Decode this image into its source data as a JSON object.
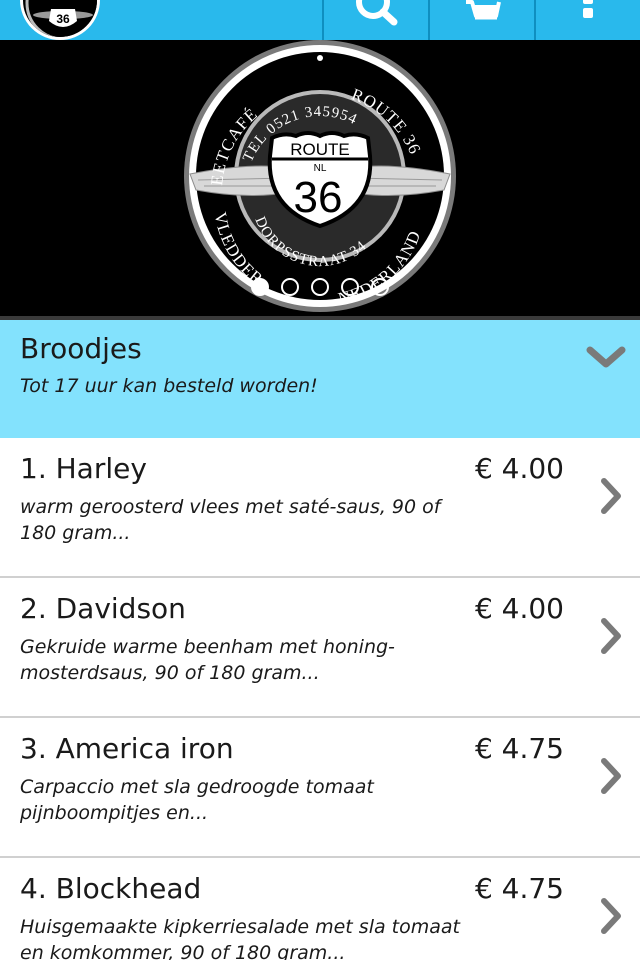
{
  "header": {
    "logo_text": "36",
    "icons": [
      "search-icon",
      "cart-icon",
      "more-icon"
    ],
    "accent_color": "#29b9ec"
  },
  "hero": {
    "badge_top_left": "EETCAFÉ",
    "badge_top_right": "ROUTE 36",
    "badge_phone": "TEL 0521 345954",
    "shield_top": "ROUTE",
    "shield_nl": "NL",
    "shield_number": "36",
    "badge_street": "DORPSSTRAAT 34",
    "badge_bottom_left": "VLEDDER",
    "badge_bottom_right": "NEDERLAND",
    "slides_total": 5,
    "active_slide": 1
  },
  "category": {
    "title": "Broodjes",
    "subtitle": "Tot 17 uur kan besteld worden!",
    "color": "#83e2fd"
  },
  "items": [
    {
      "name": "1. Harley",
      "price": "€ 4.00",
      "desc": "warm geroosterd vlees met saté-saus, 90 of 180 gram..."
    },
    {
      "name": "2. Davidson",
      "price": "€ 4.00",
      "desc": "Gekruide warme beenham met honing-mosterdsaus, 90 of 180 gram..."
    },
    {
      "name": "3. America iron",
      "price": "€ 4.75",
      "desc": "Carpaccio met sla gedroogde tomaat pijnboompitjes en..."
    },
    {
      "name": "4. Blockhead",
      "price": "€ 4.75",
      "desc": "Huisgemaakte kipkerriesalade met sla tomaat en komkommer, 90 of 180 gram..."
    }
  ]
}
